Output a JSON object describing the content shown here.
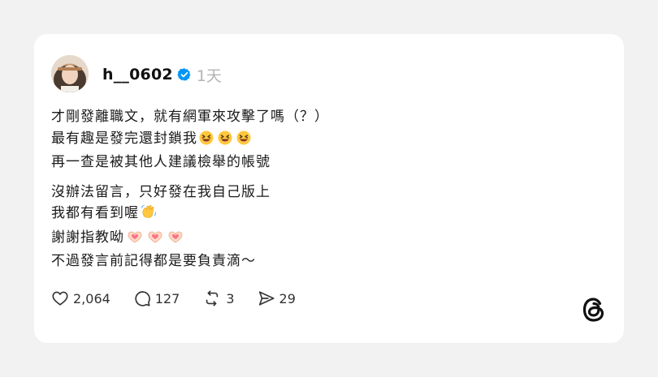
{
  "post": {
    "username": "h__0602",
    "verified": true,
    "time": "1天",
    "paragraphs": [
      {
        "lines": [
          {
            "text": "才剛發離職文，就有網軍來攻擊了嗎（？）"
          },
          {
            "text": "最有趣是發完還封鎖我",
            "emoji": "laughing-squint-face"
          },
          {
            "text": "再一查是被其他人建議檢舉的帳號"
          }
        ]
      },
      {
        "lines": [
          {
            "text": "沒辦法留言，只好發在我自己版上"
          },
          {
            "text": "我都有看到喔",
            "emoji": "waving-hand"
          },
          {
            "text": "謝謝指教呦",
            "emoji": "heart-hands"
          },
          {
            "text": "不過發言前記得都是要負責滴～"
          }
        ]
      }
    ]
  },
  "actions": {
    "likes": "2,064",
    "replies": "127",
    "reposts": "3",
    "shares": "29"
  },
  "icons": {
    "like": "heart-icon",
    "reply": "comment-bubble-icon",
    "repost": "repost-arrows-icon",
    "share": "send-arrow-icon",
    "verified": "verified-badge-icon",
    "logo": "threads-logo-icon"
  },
  "colors": {
    "background": "#f2f2f2",
    "card": "#ffffff",
    "text": "#1a1a1a",
    "muted": "#b3b3b3",
    "verified": "#0095f6"
  }
}
